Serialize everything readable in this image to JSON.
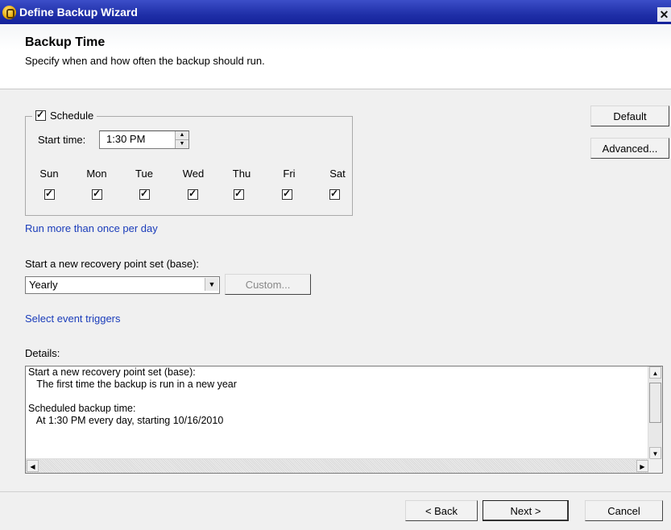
{
  "window": {
    "title": "Define Backup Wizard",
    "close_label": "✕"
  },
  "header": {
    "title": "Backup Time",
    "subtitle": "Specify when and how often the backup should run."
  },
  "schedule": {
    "label": "Schedule",
    "checked": true,
    "start_time_label": "Start time:",
    "start_time_value": "1:30 PM",
    "days": [
      {
        "label": "Sun",
        "checked": true
      },
      {
        "label": "Mon",
        "checked": true
      },
      {
        "label": "Tue",
        "checked": true
      },
      {
        "label": "Wed",
        "checked": true
      },
      {
        "label": "Thu",
        "checked": true
      },
      {
        "label": "Fri",
        "checked": true
      },
      {
        "label": "Sat",
        "checked": true
      }
    ]
  },
  "side_buttons": {
    "default": "Default",
    "advanced": "Advanced..."
  },
  "links": {
    "run_more": "Run more than once per day",
    "event_triggers": "Select event triggers"
  },
  "recovery": {
    "label": "Start a new recovery point set (base):",
    "selected": "Yearly",
    "custom_button": "Custom..."
  },
  "details": {
    "label": "Details:",
    "text": "Start a new recovery point set (base):\n   The first time the backup is run in a new year\n\nScheduled backup time:\n   At 1:30 PM every day, starting 10/16/2010"
  },
  "footer": {
    "back": "< Back",
    "next": "Next >",
    "cancel": "Cancel"
  },
  "colors": {
    "title_bar": "#1f2fa8",
    "link": "#1a3cba"
  }
}
